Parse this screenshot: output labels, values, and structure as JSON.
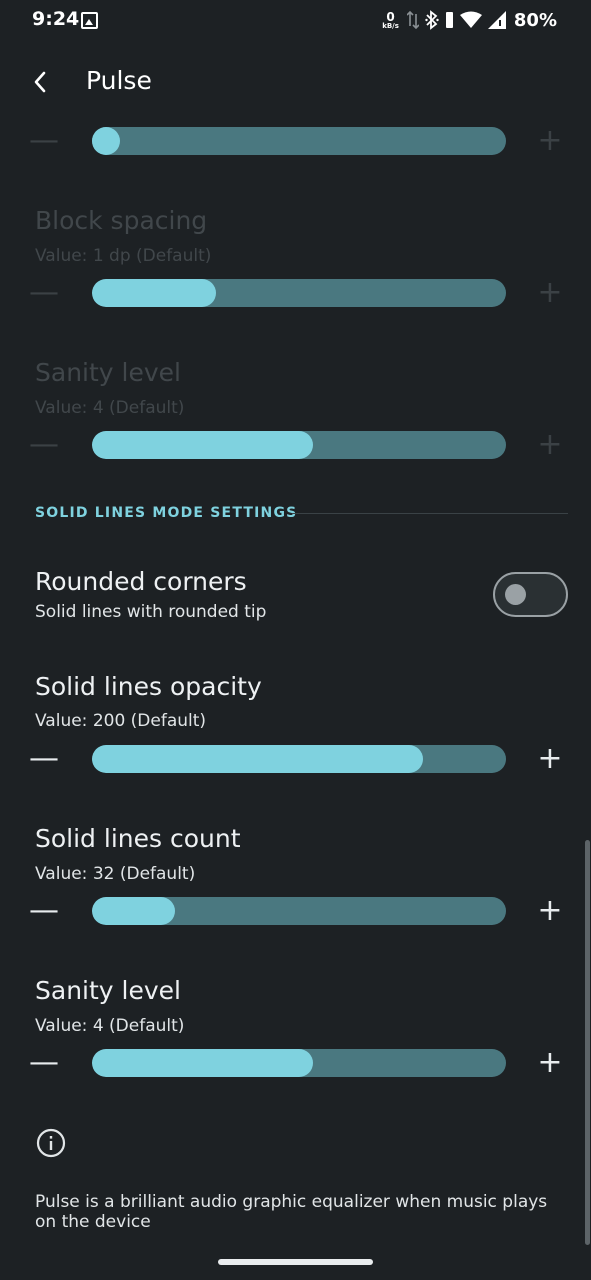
{
  "status_bar": {
    "time": "9:24",
    "net_speed_value": "0",
    "net_speed_unit": "kB/s",
    "battery": "80%",
    "icons": [
      "image-icon",
      "data-arrows-icon",
      "bluetooth-icon",
      "wifi-icon",
      "signal-icon",
      "battery-icon"
    ]
  },
  "app_bar": {
    "title": "Pulse",
    "back_icon": "chevron-left-icon"
  },
  "settings": {
    "top_slider": {
      "fraction": 0.0,
      "disabled": true
    },
    "block_spacing": {
      "title": "Block spacing",
      "value": "Value: 1 dp (Default)",
      "fraction": 0.3,
      "disabled": true
    },
    "sanity_level_disabled": {
      "title": "Sanity level",
      "value": "Value: 4 (Default)",
      "fraction": 0.535,
      "disabled": true
    }
  },
  "solid_lines": {
    "section_header": "SOLID LINES MODE SETTINGS",
    "rounded_corners": {
      "title": "Rounded corners",
      "subtitle": "Solid lines with rounded tip",
      "checked": false
    },
    "opacity": {
      "title": "Solid lines opacity",
      "value": "Value: 200 (Default)",
      "fraction": 0.8
    },
    "count": {
      "title": "Solid lines count",
      "value": "Value: 32 (Default)",
      "fraction": 0.2
    },
    "sanity_level": {
      "title": "Sanity level",
      "value": "Value: 4 (Default)",
      "fraction": 0.535
    }
  },
  "controls": {
    "minus": "—",
    "plus": "+"
  },
  "about": {
    "icon": "info-icon",
    "text": "Pulse is a brilliant audio graphic equalizer when music plays on the device"
  },
  "colors": {
    "background": "#1d2124",
    "accent": "#7fd2df",
    "track": "#4a7880",
    "disabled_text": "#41474b"
  }
}
